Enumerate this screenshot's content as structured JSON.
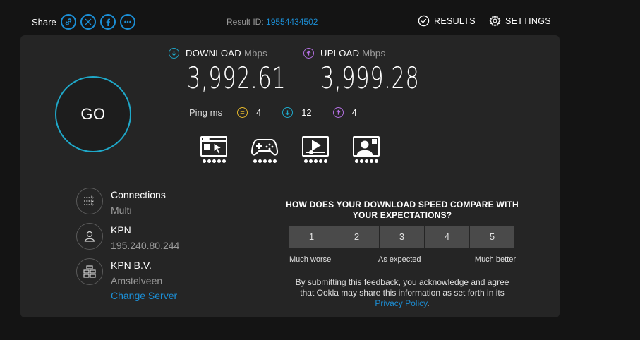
{
  "share": {
    "label": "Share",
    "buttons": [
      "link-icon",
      "x-icon",
      "facebook-icon",
      "more-icon"
    ]
  },
  "result": {
    "label": "Result ID:",
    "id": "19554434502"
  },
  "nav": {
    "results": "RESULTS",
    "settings": "SETTINGS"
  },
  "go": {
    "label": "GO"
  },
  "download": {
    "label": "DOWNLOAD",
    "unit": "Mbps",
    "value": "3,992.61"
  },
  "upload": {
    "label": "UPLOAD",
    "unit": "Mbps",
    "value": "3,999.28"
  },
  "ping": {
    "label": "Ping ms",
    "idle": "4",
    "download": "12",
    "upload": "4"
  },
  "use_cases": [
    {
      "icon": "web-browsing-icon",
      "rating_dots": 5
    },
    {
      "icon": "gaming-icon",
      "rating_dots": 5
    },
    {
      "icon": "video-streaming-icon",
      "rating_dots": 5
    },
    {
      "icon": "video-chat-icon",
      "rating_dots": 5
    }
  ],
  "server": {
    "connections_label": "Connections",
    "connections_value": "Multi",
    "isp_name": "KPN",
    "ip": "195.240.80.244",
    "host_name": "KPN B.V.",
    "host_location": "Amstelveen",
    "change_label": "Change Server"
  },
  "survey": {
    "question": "HOW DOES YOUR DOWNLOAD SPEED COMPARE WITH YOUR EXPECTATIONS?",
    "options": [
      "1",
      "2",
      "3",
      "4",
      "5"
    ],
    "scale_low": "Much worse",
    "scale_mid": "As expected",
    "scale_high": "Much better",
    "notice": "By submitting this feedback, you acknowledge and agree that Ookla may share this information as set forth in its",
    "privacy_link": "Privacy Policy",
    "notice_end": "."
  },
  "colors": {
    "accent_blue": "#1c8fd6",
    "download_teal": "#1fa8c9",
    "upload_purple": "#b26fe0",
    "ping_yellow": "#e4b72b"
  }
}
